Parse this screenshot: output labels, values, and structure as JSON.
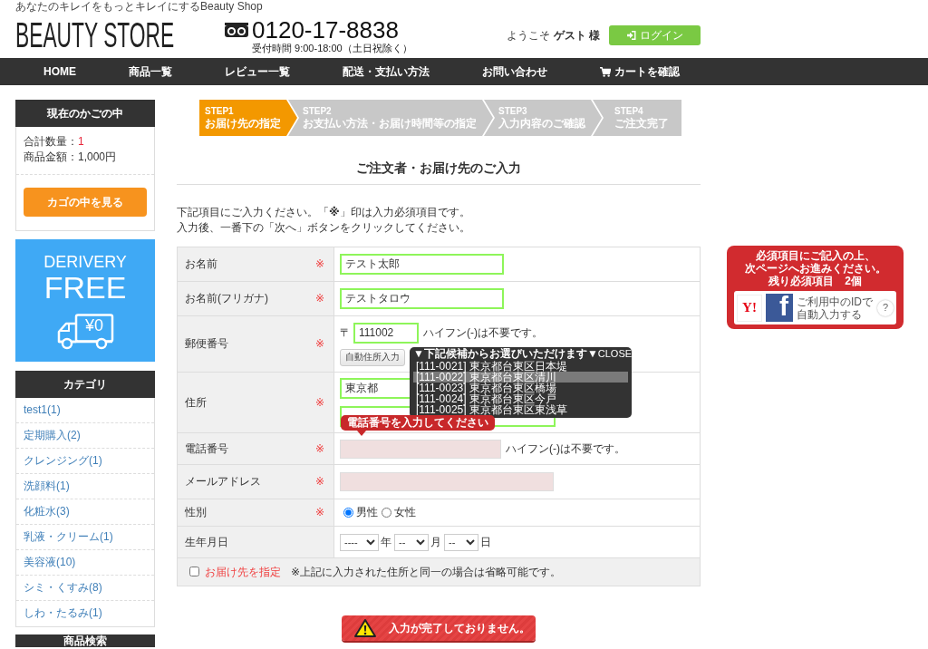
{
  "header": {
    "tagline": "あなたのキレイをもっとキレイにするBeauty Shop",
    "logo": "BEAUTY STORE",
    "phone": "0120-17-8838",
    "hours": "受付時間 9:00-18:00（土日祝除く）",
    "welcome": "ようこそ **ゲスト 様**",
    "login": "ログイン"
  },
  "nav": [
    {
      "label": "HOME",
      "kind": "link"
    },
    {
      "label": "商品一覧",
      "kind": "link"
    },
    {
      "label": "レビュー一覧",
      "kind": "link"
    },
    {
      "label": "配送・支払い方法",
      "kind": "link"
    },
    {
      "label": "お問い合わせ",
      "kind": "link"
    },
    {
      "label": "カートを確認",
      "kind": "cart"
    }
  ],
  "sidebar": {
    "cart": {
      "title": "現在のかごの中",
      "quantity_label": "合計数量：",
      "quantity": "1",
      "amount": "商品金額：1,000円",
      "button": "カゴの中を見る"
    },
    "banner": {
      "line_1": "DERIVERY",
      "line_2": "FREE",
      "price": "¥0"
    },
    "categories": {
      "title": "カテゴリ",
      "items": [
        {
          "label": "test1(1)"
        },
        {
          "label": "定期購入(2)"
        },
        {
          "label": "クレンジング(1)"
        },
        {
          "label": "洗顔料(1)"
        },
        {
          "label": "化粧水(3)"
        },
        {
          "label": "乳液・クリーム(1)"
        },
        {
          "label": "美容液(10)"
        },
        {
          "label": "シミ・くすみ(8)"
        },
        {
          "label": "しわ・たるみ(1)"
        }
      ]
    },
    "search": {
      "title": "商品検索"
    }
  },
  "steps": [
    {
      "number": "STEP1",
      "label": "お届け先の指定",
      "current": true
    },
    {
      "number": "STEP2",
      "label": "お支払い方法・お届け時間等の指定",
      "current": false
    },
    {
      "number": "STEP3",
      "label": "入力内容のご確認",
      "current": false
    },
    {
      "number": "STEP4",
      "label": "ご注文完了",
      "current": false
    }
  ],
  "form": {
    "title": "ご注文者・お届け先のご入力",
    "intro": [
      "下記項目にご入力ください。「**※**」印は入力必須項目です。",
      "入力後、一番下の「次へ」ボタンをクリックしてください。"
    ],
    "required_mark": "※",
    "rows": [
      {
        "kind": "text",
        "label": "お名前",
        "required": true,
        "value": "テスト太郎",
        "error": false
      },
      {
        "kind": "text",
        "label": "お名前(フリガナ)",
        "required": true,
        "value": "テストタロウ",
        "error": false
      },
      {
        "kind": "postal",
        "label": "郵便番号",
        "required": true,
        "prefix": "〒",
        "value": "111002",
        "error": false,
        "note": "ハイフン(-)は不要です。",
        "button": "自動住所入力"
      },
      {
        "kind": "address",
        "label": "住所",
        "required": true,
        "fields": [
          {
            "value": "東京都",
            "error": false
          },
          {
            "error": false
          }
        ]
      },
      {
        "kind": "text",
        "label": "電話番号",
        "required": true,
        "error": true,
        "note": "ハイフン(-)は不要です。"
      },
      {
        "kind": "text",
        "label": "メールアドレス",
        "required": true,
        "error": true
      },
      {
        "kind": "radio",
        "label": "性別",
        "required": true,
        "options": [
          {
            "label": "男性",
            "selected": true
          },
          {
            "label": "女性",
            "selected": false
          }
        ]
      },
      {
        "kind": "date",
        "label": "生年月日",
        "required": false,
        "selects": [
          {
            "value": "----",
            "unit": "年"
          },
          {
            "value": "--",
            "unit": "月"
          },
          {
            "value": "--",
            "unit": "日"
          }
        ]
      }
    ],
    "delivery_option": {
      "checked": false,
      "label": "お届け先を指定",
      "note": "※上記に入力された住所と同一の場合は省略可能です。"
    },
    "address_candidates": {
      "title": "▼下記候補からお選びいただけます▼",
      "close": "CLOSE",
      "items": [
        {
          "text": "[111-0021] 東京都台東区日本堤",
          "selected": false
        },
        {
          "text": "[111-0022] 東京都台東区清川",
          "selected": true
        },
        {
          "text": "[111-0023] 東京都台東区橋場",
          "selected": false
        },
        {
          "text": "[111-0024] 東京都台東区今戸",
          "selected": false
        },
        {
          "text": "[111-0025] 東京都台東区東浅草",
          "selected": false
        }
      ]
    },
    "error_tooltip": "電話番号を入力してください",
    "submit": "入力が完了しておりません。"
  },
  "notice": {
    "message": [
      "**必須項目**にご記入の上、",
      "次ページへお進みください。"
    ],
    "remaining": "残り必須項目　**2個**",
    "id_login": {
      "y_logo": "Y!",
      "f_logo": "f",
      "text": [
        "ご利用中のIDで",
        "自動入力する"
      ],
      "help": "?"
    }
  }
}
